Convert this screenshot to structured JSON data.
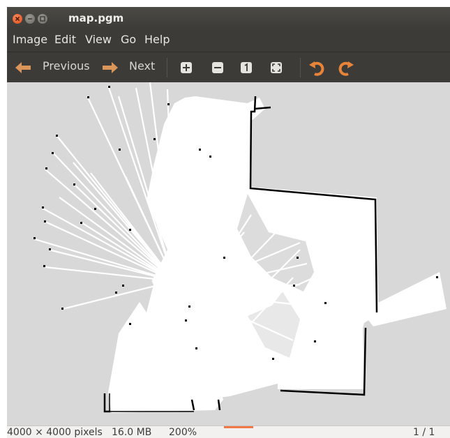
{
  "window": {
    "title": "map.pgm"
  },
  "menu": {
    "items": [
      "Image",
      "Edit",
      "View",
      "Go",
      "Help"
    ]
  },
  "toolbar": {
    "previous_label": "Previous",
    "next_label": "Next",
    "icons": [
      "arrow-left-icon",
      "arrow-right-icon",
      "zoom-in-icon",
      "zoom-out-icon",
      "zoom-normal-icon",
      "zoom-fit-icon",
      "rotate-left-icon",
      "rotate-right-icon"
    ]
  },
  "status": {
    "dimensions": "4000 × 4000 pixels",
    "size": "16.0 MB",
    "zoom": "200%",
    "page": "1 / 1"
  },
  "colors": {
    "accent": "#f07746",
    "titlebar": "#3c3b37",
    "canvas": "#d8d8d8",
    "map_free": "#ffffff",
    "map_wall": "#000000"
  }
}
